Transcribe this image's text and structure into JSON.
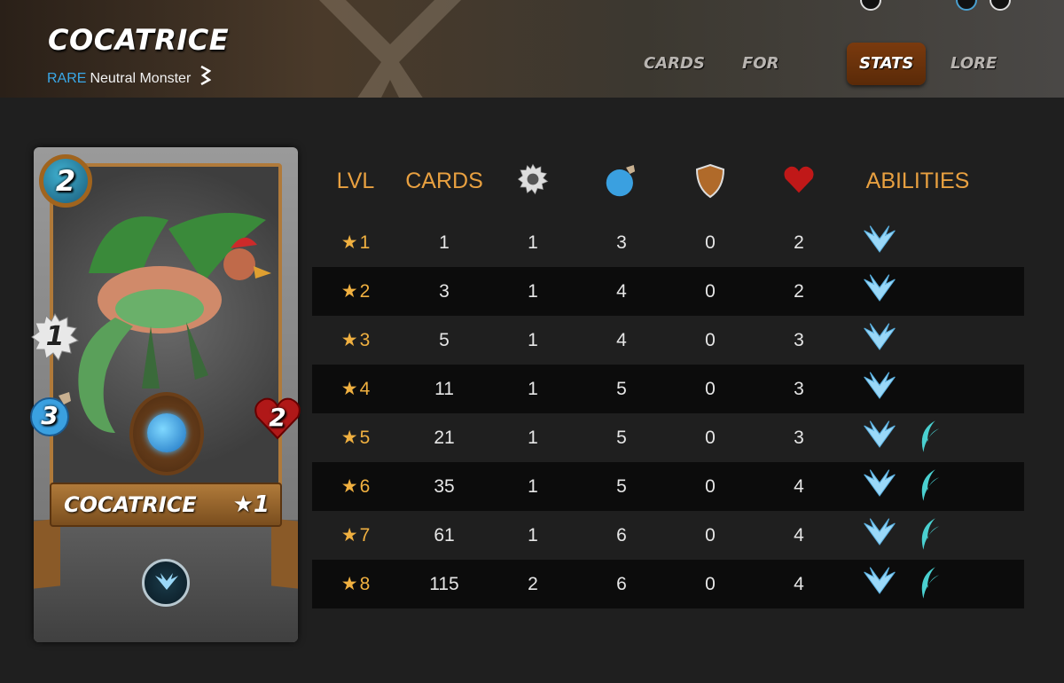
{
  "header": {
    "title": "COCATRICE",
    "rarity": "RARE",
    "type_label": "Neutral Monster",
    "tabs": [
      {
        "label": "CARDS",
        "active": false
      },
      {
        "label": "FOR SALE",
        "active": false
      },
      {
        "label": "STATS",
        "active": true
      },
      {
        "label": "LORE",
        "active": false
      }
    ]
  },
  "card": {
    "name": "COCATRICE",
    "level_label": "★1",
    "mana": "2",
    "attack": "1",
    "speed": "3",
    "health": "2",
    "ability_icon": "flying-icon"
  },
  "table": {
    "headers": {
      "lvl": "LVL",
      "cards": "CARDS",
      "attack_icon": "melee-attack-icon",
      "speed_icon": "speed-icon",
      "armor_icon": "armor-shield-icon",
      "health_icon": "health-heart-icon",
      "abilities": "ABILITIES"
    },
    "rows": [
      {
        "lvl": "1",
        "cards": "1",
        "attack": "1",
        "speed": "3",
        "armor": "0",
        "health": "2",
        "abilities": [
          "flying-icon"
        ]
      },
      {
        "lvl": "2",
        "cards": "3",
        "attack": "1",
        "speed": "4",
        "armor": "0",
        "health": "2",
        "abilities": [
          "flying-icon"
        ]
      },
      {
        "lvl": "3",
        "cards": "5",
        "attack": "1",
        "speed": "4",
        "armor": "0",
        "health": "3",
        "abilities": [
          "flying-icon"
        ]
      },
      {
        "lvl": "4",
        "cards": "11",
        "attack": "1",
        "speed": "5",
        "armor": "0",
        "health": "3",
        "abilities": [
          "flying-icon"
        ]
      },
      {
        "lvl": "5",
        "cards": "21",
        "attack": "1",
        "speed": "5",
        "armor": "0",
        "health": "3",
        "abilities": [
          "flying-icon",
          "dodge-icon"
        ]
      },
      {
        "lvl": "6",
        "cards": "35",
        "attack": "1",
        "speed": "5",
        "armor": "0",
        "health": "4",
        "abilities": [
          "flying-icon",
          "dodge-icon"
        ]
      },
      {
        "lvl": "7",
        "cards": "61",
        "attack": "1",
        "speed": "6",
        "armor": "0",
        "health": "4",
        "abilities": [
          "flying-icon",
          "dodge-icon"
        ]
      },
      {
        "lvl": "8",
        "cards": "115",
        "attack": "2",
        "speed": "6",
        "armor": "0",
        "health": "4",
        "abilities": [
          "flying-icon",
          "dodge-icon"
        ]
      }
    ]
  },
  "colors": {
    "accent": "#e8a040",
    "rarity": "#3aa8e8",
    "active_tab": "#6a3210"
  }
}
